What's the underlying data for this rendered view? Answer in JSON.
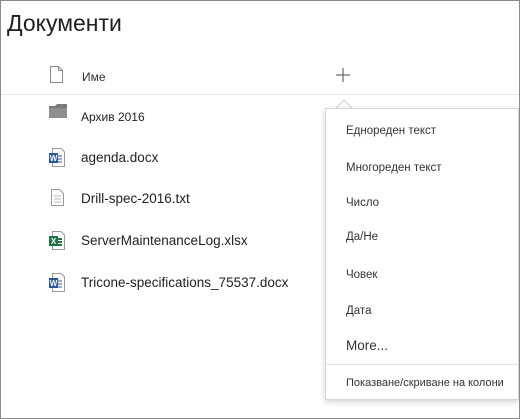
{
  "page": {
    "title": "Документи"
  },
  "header": {
    "name_label": "Име",
    "add_column_icon": "plus-icon"
  },
  "files": [
    {
      "name": "Архив 2016",
      "icon": "folder-icon",
      "type": "folder"
    },
    {
      "name": "agenda.docx",
      "icon": "word-file-icon",
      "type": "word"
    },
    {
      "name": "Drill-spec-2016.txt",
      "icon": "text-file-icon",
      "type": "text"
    },
    {
      "name": "ServerMaintenanceLog.xlsx",
      "icon": "excel-file-icon",
      "type": "excel"
    },
    {
      "name": "Tricone-specifications_75537.docx",
      "icon": "word-file-icon",
      "type": "word"
    }
  ],
  "add_column_menu": {
    "items": [
      "Еднореден текст",
      "Многореден текст",
      "Число",
      "Да/Не",
      "Човек",
      "Дата"
    ],
    "more": "More...",
    "show_hide": "Показване/скриване на колони"
  },
  "colors": {
    "word": "#2b5797",
    "excel": "#217346",
    "folder": "#7a7a7a"
  }
}
